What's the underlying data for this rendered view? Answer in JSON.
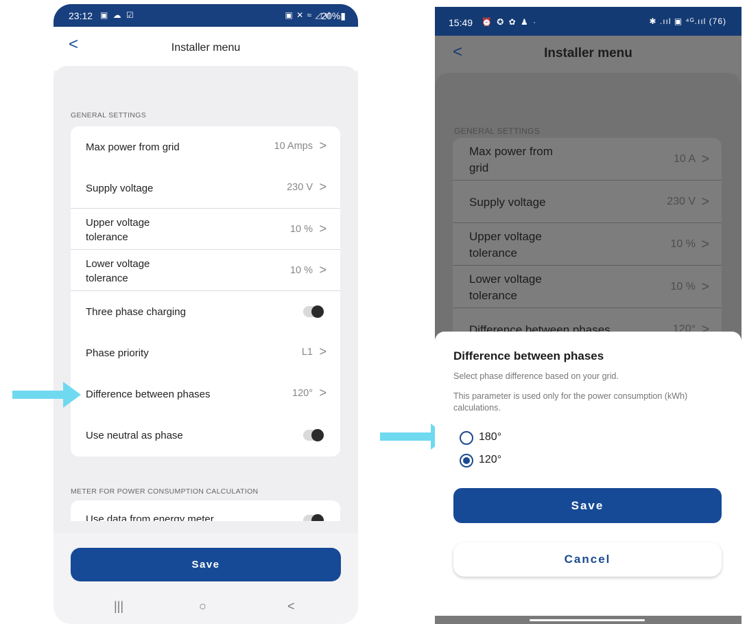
{
  "left": {
    "status_bar": {
      "time": "23:12",
      "left_icons": "▣ ☁ ☑",
      "right_icons": "▣ ✕ ≈ ◿.ıl",
      "battery": "20%▮"
    },
    "header": {
      "back": "<",
      "title": "Installer menu"
    },
    "general_section": "GENERAL SETTINGS",
    "rows": [
      {
        "label": "Max power from grid",
        "value": "10 Amps",
        "chevron": ">"
      },
      {
        "label": "Supply voltage",
        "value": "230 V",
        "chevron": ">"
      },
      {
        "label_line1": "Upper voltage",
        "label_line2": "tolerance",
        "value": "10 %",
        "chevron": ">"
      },
      {
        "label_line1": "Lower voltage",
        "label_line2": "tolerance",
        "value": "10 %",
        "chevron": ">"
      },
      {
        "label": "Three phase charging",
        "toggle": "off"
      },
      {
        "label": "Phase priority",
        "value": "L1",
        "chevron": ">"
      },
      {
        "label": "Difference between phases",
        "value": "120°",
        "chevron": ">"
      },
      {
        "label": "Use neutral as phase",
        "toggle": "off"
      }
    ],
    "meter_section": "METER FOR POWER CONSUMPTION CALCULATION",
    "meter_row": {
      "label": "Use data from energy meter",
      "toggle": "off"
    },
    "save": "Save",
    "nav": {
      "recents": "|||",
      "home": "○",
      "back": "<"
    }
  },
  "right": {
    "status_bar": {
      "time": "15:49",
      "left_icons": "⏰ ✪ ✿ ♟ ·",
      "right_icons": "✱ .ııl ▣ ⁴ᴳ.ııl (76)"
    },
    "header": {
      "back": "<",
      "title": "Installer menu"
    },
    "general_section": "GENERAL SETTINGS",
    "rows": [
      {
        "label_line1": "Max power from",
        "label_line2": "grid",
        "value": "10 A",
        "chevron": ">"
      },
      {
        "label": "Supply voltage",
        "value": "230 V",
        "chevron": ">"
      },
      {
        "label_line1": "Upper voltage",
        "label_line2": "tolerance",
        "value": "10 %",
        "chevron": ">"
      },
      {
        "label_line1": "Lower voltage",
        "label_line2": "tolerance",
        "value": "10 %",
        "chevron": ">"
      },
      {
        "label": "Difference between phases",
        "value": "120°",
        "chevron": ">"
      }
    ],
    "sheet": {
      "title": "Difference between phases",
      "description": "Select phase difference based on your grid.",
      "note": "This parameter is used only for the power consumption (kWh) calculations.",
      "options": [
        {
          "label": "180°",
          "selected": false
        },
        {
          "label": "120°",
          "selected": true
        }
      ],
      "save": "Save",
      "cancel": "Cancel"
    }
  },
  "colors": {
    "primary": "#164a96",
    "arrow": "#6fd9f0",
    "status_bar": "#183f7e"
  }
}
